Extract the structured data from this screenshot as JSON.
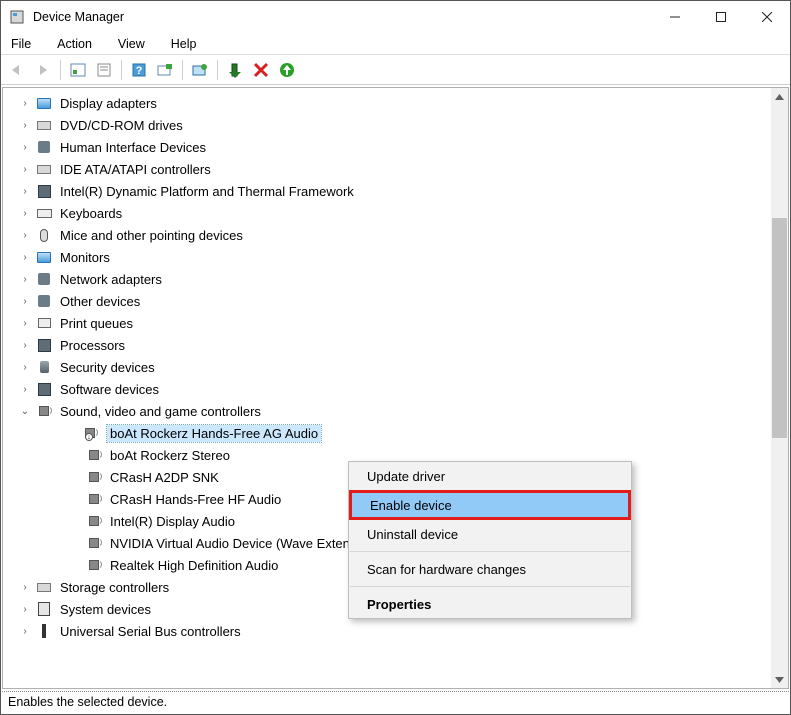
{
  "window": {
    "title": "Device Manager"
  },
  "menu": {
    "file": "File",
    "action": "Action",
    "view": "View",
    "help": "Help"
  },
  "tree": {
    "items": [
      {
        "label": "Display adapters",
        "icon": "display-adapter-icon",
        "expanded": false
      },
      {
        "label": "DVD/CD-ROM drives",
        "icon": "dvd-drive-icon",
        "expanded": false
      },
      {
        "label": "Human Interface Devices",
        "icon": "hid-icon",
        "expanded": false
      },
      {
        "label": "IDE ATA/ATAPI controllers",
        "icon": "ide-controller-icon",
        "expanded": false
      },
      {
        "label": "Intel(R) Dynamic Platform and Thermal Framework",
        "icon": "chip-icon",
        "expanded": false
      },
      {
        "label": "Keyboards",
        "icon": "keyboard-icon",
        "expanded": false
      },
      {
        "label": "Mice and other pointing devices",
        "icon": "mouse-icon",
        "expanded": false
      },
      {
        "label": "Monitors",
        "icon": "monitor-icon",
        "expanded": false
      },
      {
        "label": "Network adapters",
        "icon": "network-adapter-icon",
        "expanded": false
      },
      {
        "label": "Other devices",
        "icon": "other-device-icon",
        "expanded": false
      },
      {
        "label": "Print queues",
        "icon": "printer-icon",
        "expanded": false
      },
      {
        "label": "Processors",
        "icon": "processor-icon",
        "expanded": false
      },
      {
        "label": "Security devices",
        "icon": "security-device-icon",
        "expanded": false
      },
      {
        "label": "Software devices",
        "icon": "software-device-icon",
        "expanded": false
      },
      {
        "label": "Sound, video and game controllers",
        "icon": "sound-controller-icon",
        "expanded": true,
        "children": [
          {
            "label": "boAt Rockerz Hands-Free AG Audio",
            "icon": "audio-device-icon",
            "selected": true,
            "disabled": true
          },
          {
            "label": "boAt Rockerz Stereo",
            "icon": "audio-device-icon"
          },
          {
            "label": "CRasH A2DP SNK",
            "icon": "audio-device-icon"
          },
          {
            "label": "CRasH Hands-Free HF Audio",
            "icon": "audio-device-icon"
          },
          {
            "label": "Intel(R) Display Audio",
            "icon": "audio-device-icon"
          },
          {
            "label": "NVIDIA Virtual Audio Device (Wave Extensible) (WDM)",
            "icon": "audio-device-icon"
          },
          {
            "label": "Realtek High Definition Audio",
            "icon": "audio-device-icon"
          }
        ]
      },
      {
        "label": "Storage controllers",
        "icon": "storage-controller-icon",
        "expanded": false
      },
      {
        "label": "System devices",
        "icon": "system-device-icon",
        "expanded": false
      },
      {
        "label": "Universal Serial Bus controllers",
        "icon": "usb-controller-icon",
        "expanded": false
      }
    ]
  },
  "context_menu": {
    "update_driver": "Update driver",
    "enable_device": "Enable device",
    "uninstall_device": "Uninstall device",
    "scan_hardware": "Scan for hardware changes",
    "properties": "Properties"
  },
  "statusbar": {
    "text": "Enables the selected device."
  }
}
